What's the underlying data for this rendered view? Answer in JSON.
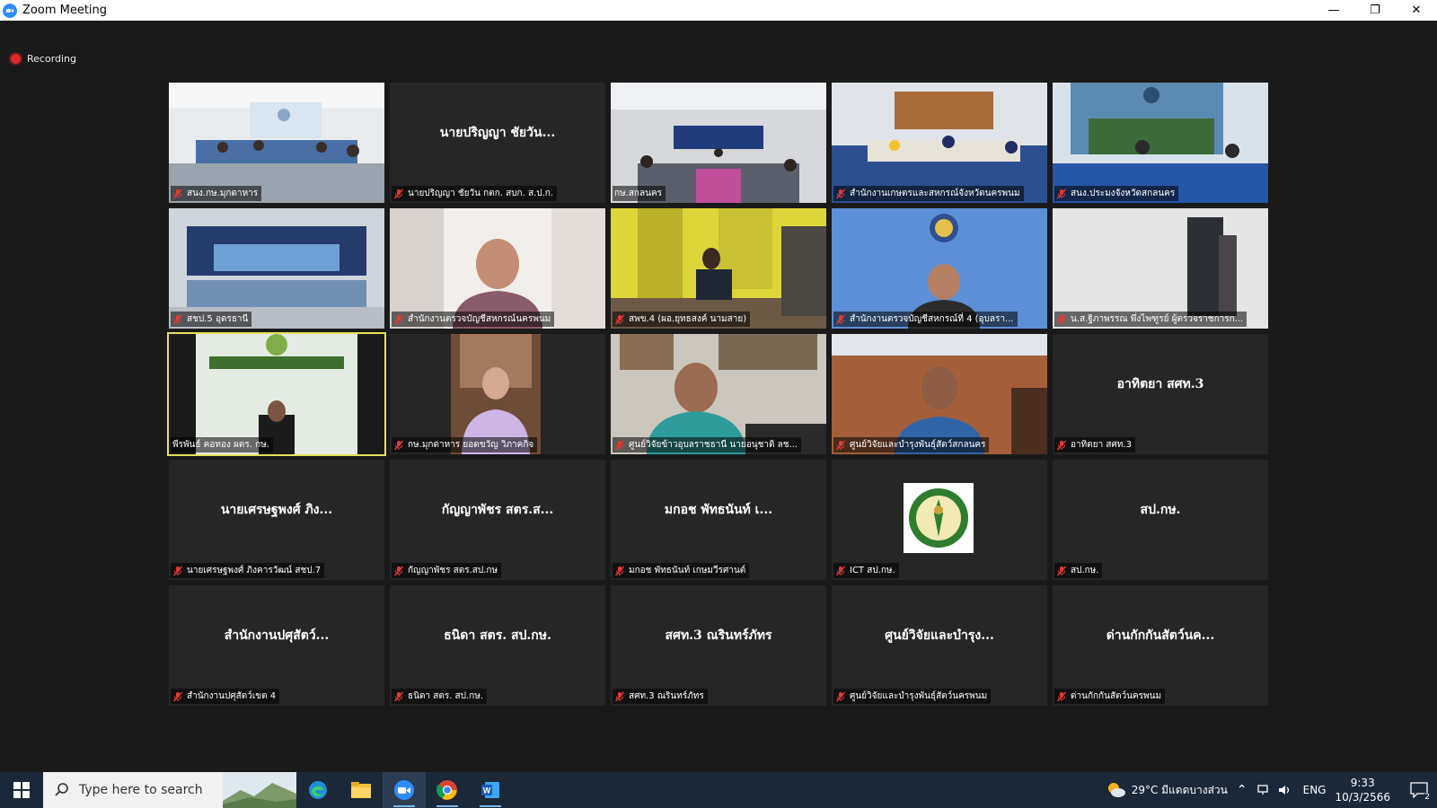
{
  "window": {
    "title": "Zoom Meeting",
    "minimize": "—",
    "restore": "❐",
    "close": "✕"
  },
  "recording": {
    "label": "Recording"
  },
  "participants": [
    {
      "name": "สนง.กษ.มุกดาหาร",
      "muted": true,
      "video": true
    },
    {
      "name": "นายปริญญา ชัยวัน กตก. สบก. ส.ป.ก.",
      "display": "นายปริญญา ชัยวัน...",
      "muted": true,
      "video": false
    },
    {
      "name": "กษ.สกลนคร",
      "muted": false,
      "video": true
    },
    {
      "name": "สำนักงานเกษตรและสหกรณ์จังหวัดนครพนม",
      "muted": true,
      "video": true
    },
    {
      "name": "สนง.ประมงจังหวัดสกลนคร",
      "muted": true,
      "video": true
    },
    {
      "name": "สชป.5 อุดรธานี",
      "muted": true,
      "video": true
    },
    {
      "name": "สำนักงานตรวจบัญชีสหกรณ์นครพนม",
      "muted": true,
      "video": true
    },
    {
      "name": "สพข.4 (ผอ.ยุทธสงค์ นามสาย)",
      "muted": true,
      "video": true
    },
    {
      "name": "สำนักงานตรวจบัญชีสหกรณ์ที่ 4 (อุบลรา...",
      "muted": true,
      "video": true
    },
    {
      "name": "น.ส.ฐิภาพรรณ พึ่งไพฑูรย์ ผู้ตรวจราชการก...",
      "muted": true,
      "video": true
    },
    {
      "name": "พีรพันธ์ คอทอง ผตร. กษ.",
      "muted": false,
      "video": true,
      "active": true
    },
    {
      "name": "กษ.มุกดาหาร ยอดขวัญ วิภาคกิจ",
      "muted": true,
      "video": true
    },
    {
      "name": "ศูนย์วิจัยข้าวอุบลราชธานี นายอนุชาติ ลช...",
      "muted": true,
      "video": true
    },
    {
      "name": "ศูนย์วิจัยและบำรุงพันธุ์สัตว์สกลนคร",
      "muted": true,
      "video": true
    },
    {
      "name": "อาทิตยา สศท.3",
      "display": "อาทิตยา สศท.3",
      "muted": true,
      "video": false
    },
    {
      "name": "นายเศรษฐพงศ์ ภิงคารวัฒน์ สชป.7",
      "display": "นายเศรษฐพงศ์ ภิง...",
      "muted": true,
      "video": false
    },
    {
      "name": "กัญญาพัชร สตร.สป.กษ",
      "display": "กัญญาพัชร สตร.ส...",
      "muted": true,
      "video": false
    },
    {
      "name": "มกอช พัทธนันท์ เกษมวีรศานต์",
      "display": "มกอช พัทธนันท์ เ...",
      "muted": true,
      "video": false
    },
    {
      "name": "ICT สป.กษ.",
      "muted": true,
      "video": false,
      "logo": true
    },
    {
      "name": "สป.กษ.",
      "display": "สป.กษ.",
      "muted": true,
      "video": false
    },
    {
      "name": "สำนักงานปศุสัตว์เขต 4",
      "display": "สำนักงานปศุสัตว์...",
      "muted": true,
      "video": false
    },
    {
      "name": "ธนิดา สตร. สป.กษ.",
      "display": "ธนิดา สตร. สป.กษ.",
      "muted": true,
      "video": false
    },
    {
      "name": "สศท.3 ณรินทร์ภัทร",
      "display": "สศท.3 ณรินทร์ภัทร",
      "muted": true,
      "video": false
    },
    {
      "name": "ศูนย์วิจัยและบำรุงพันธุ์สัตว์นครพนม",
      "display": "ศูนย์วิจัยและบำรุง...",
      "muted": true,
      "video": false
    },
    {
      "name": "ด่านกักกันสัตว์นครพนม",
      "display": "ด่านกักกันสัตว์นค...",
      "muted": true,
      "video": false
    }
  ],
  "taskbar": {
    "search_placeholder": "Type here to search",
    "apps": [
      "windows-start",
      "edge",
      "file-explorer",
      "zoom",
      "chrome",
      "word"
    ],
    "weather": "29°C มีแดดบางส่วน",
    "language": "ENG",
    "time": "9:33",
    "date": "10/3/2566",
    "notifications": "2"
  },
  "colors": {
    "active_speaker": "#e6e05a",
    "mute_icon": "#e53935",
    "zoom_blue": "#2d8cff"
  }
}
